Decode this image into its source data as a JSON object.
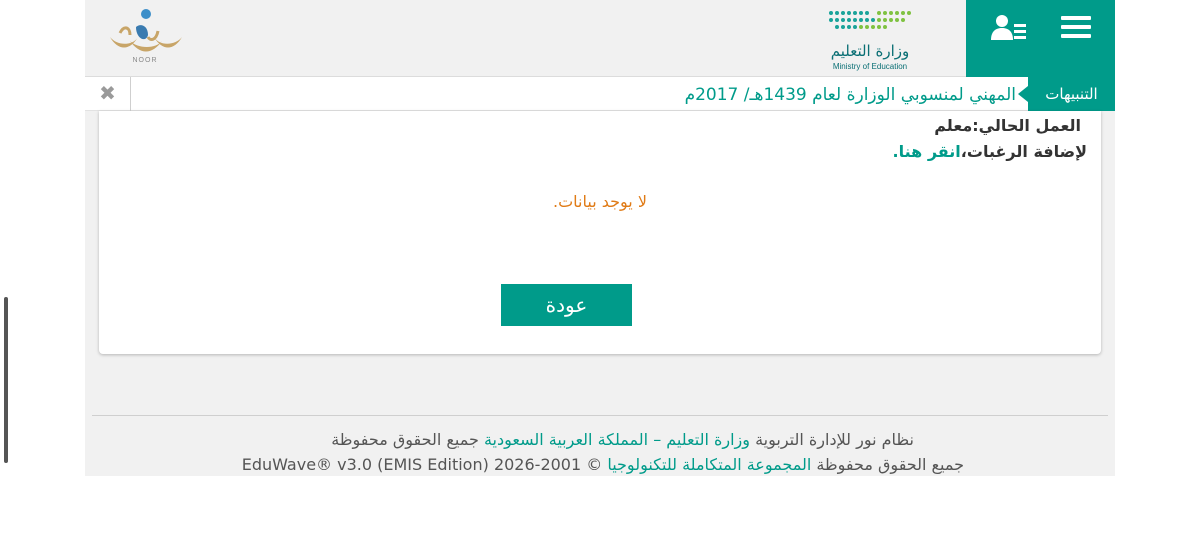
{
  "header": {
    "moe_logo_arabic": "وزارة التعليم",
    "moe_logo_english": "Ministry of Education",
    "noor_logo_text": "NOOR",
    "icons": {
      "menu": "hamburger-icon",
      "user": "user-list-icon"
    }
  },
  "ticker": {
    "label": "التنبيهات",
    "text": "المهني لمنسوبي الوزارة لعام 1439هـ/ 2017م",
    "close_glyph": "✖"
  },
  "content": {
    "work_label": "العمل الحالي:",
    "work_value": "معلم",
    "wish_prefix": "لإضافة الرغبات،",
    "wish_link": "انقر هنا.",
    "no_data": "لا يوجد بيانات.",
    "back_button": "عودة"
  },
  "footer": {
    "line1_part1": "نظام نور للإدارة التربوية ",
    "line1_link": "وزارة التعليم – المملكة العربية السعودية",
    "line1_part2": " جميع الحقوق محفوظة",
    "line2_part1": "جميع الحقوق محفوظة ",
    "line2_link": "المجموعة المتكاملة للتكنولوجيا",
    "line2_part2": " © 2001-2026 (EMIS Edition) EduWave® v3.0"
  },
  "colors": {
    "primary": "#009b8a",
    "warning": "#e07b16",
    "text": "#333333"
  }
}
